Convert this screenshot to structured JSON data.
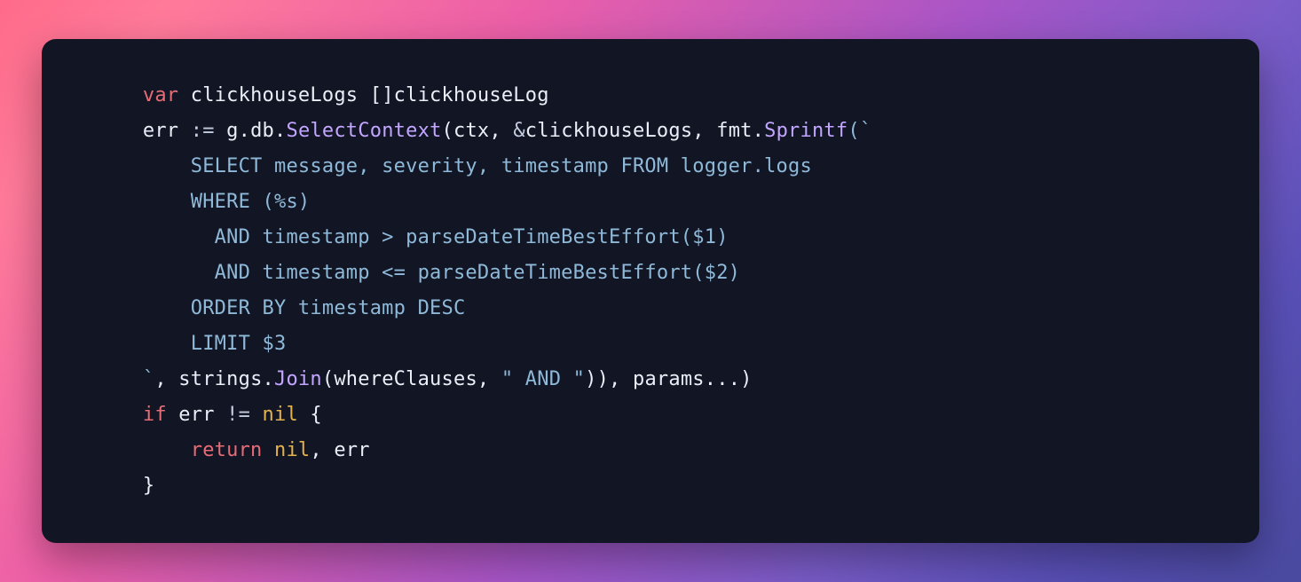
{
  "code": {
    "l1": {
      "indent": "    ",
      "var_kw": "var",
      "rest": " clickhouseLogs []clickhouseLog"
    },
    "l2": {
      "indent": "    ",
      "lhs": "err ",
      "walrus": ":=",
      "gdb": " g.db.",
      "selctx": "SelectContext",
      "args_a": "(ctx, ",
      "amp": "&",
      "args_b": "clickhouseLogs, fmt.",
      "sprintf": "Sprintf",
      "open_btick": "(`"
    },
    "l3": {
      "indent": "        ",
      "sql": "SELECT message, severity, timestamp FROM logger.logs"
    },
    "l4": {
      "indent": "        ",
      "sql": "WHERE (%s)"
    },
    "l5": {
      "indent": "          ",
      "sql": "AND timestamp > parseDateTimeBestEffort($1)"
    },
    "l6": {
      "indent": "          ",
      "sql": "AND timestamp <= parseDateTimeBestEffort($2)"
    },
    "l7": {
      "indent": "        ",
      "sql": "ORDER BY timestamp DESC"
    },
    "l8": {
      "indent": "        ",
      "sql": "LIMIT $3"
    },
    "l9": {
      "indent": "    ",
      "close_btick": "`",
      "comma": ", strings.",
      "join": "Join",
      "args_c": "(whereClauses, ",
      "and_str": "\" AND \"",
      "tail": ")), params...)"
    },
    "l10": {
      "indent": "    ",
      "if_kw": "if",
      "mid": " err ",
      "neq": "!=",
      "sp": " ",
      "nil": "nil",
      "brace": " {"
    },
    "l11": {
      "indent": "        ",
      "return_kw": "return",
      "sp": " ",
      "nil": "nil",
      "rest": ", err"
    },
    "l12": {
      "indent": "    ",
      "brace": "}"
    }
  }
}
